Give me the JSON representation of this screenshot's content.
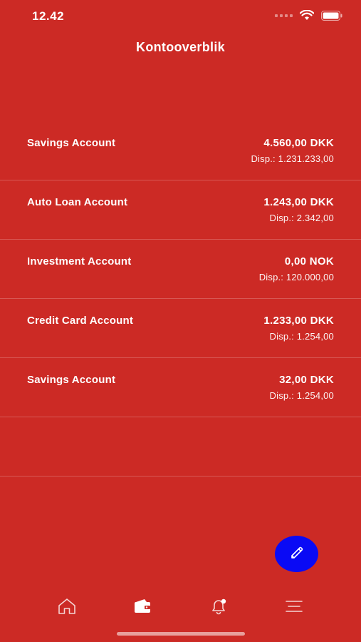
{
  "status_bar": {
    "time": "12.42"
  },
  "header": {
    "title": "Kontooverblik"
  },
  "accounts": [
    {
      "name": "Savings Account",
      "amount": "4.560,00 DKK",
      "available": "Disp.: 1.231.233,00"
    },
    {
      "name": "Auto Loan Account",
      "amount": "1.243,00 DKK",
      "available": "Disp.: 2.342,00"
    },
    {
      "name": "Investment Account",
      "amount": "0,00 NOK",
      "available": "Disp.: 120.000,00"
    },
    {
      "name": "Credit Card Account",
      "amount": "1.233,00 DKK",
      "available": "Disp.: 1.254,00"
    },
    {
      "name": "Savings Account",
      "amount": "32,00 DKK",
      "available": "Disp.: 1.254,00"
    }
  ],
  "fab": {
    "icon": "edit-pencil-icon"
  },
  "tab_bar": {
    "tabs": [
      {
        "icon": "home-icon"
      },
      {
        "icon": "wallet-icon",
        "active": true
      },
      {
        "icon": "bell-notification-icon"
      },
      {
        "icon": "menu-icon"
      }
    ]
  },
  "colors": {
    "background": "#cc2a25",
    "fab": "#0a0af5",
    "text": "#ffffff"
  }
}
